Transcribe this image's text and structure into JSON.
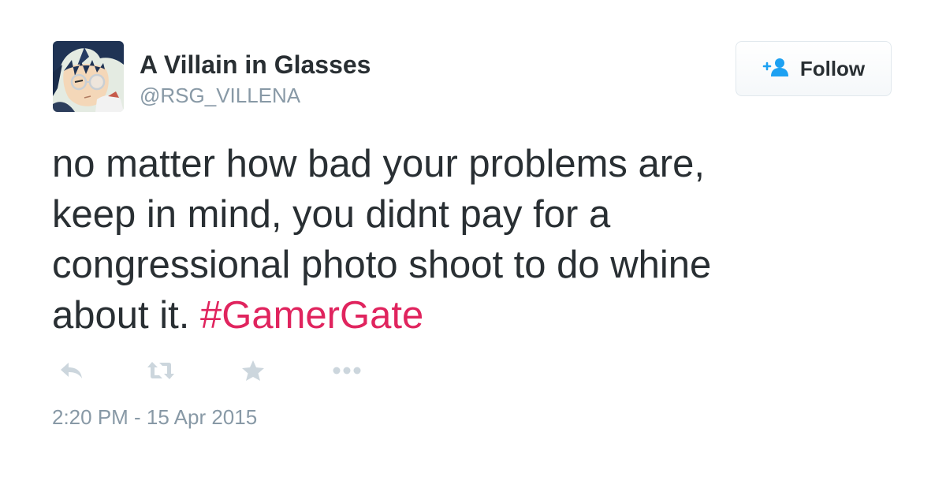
{
  "user": {
    "display_name": "A Villain in Glasses",
    "screen_name": "@RSG_VILLENA",
    "avatar_icon": "anime-character-avatar"
  },
  "follow_button": {
    "label": "Follow",
    "icon": "add-user-icon"
  },
  "tweet": {
    "line_1": "no matter how bad your problems are,",
    "line_2": "keep in mind, you didnt pay for a",
    "line_3": "congressional photo shoot to do whine",
    "line_4_text": "about it. ",
    "hashtag_symbol": "#",
    "hashtag_word": "GamerGate",
    "timestamp": "2:20 PM - 15 Apr 2015"
  },
  "actions": [
    {
      "icon": "reply-icon"
    },
    {
      "icon": "retweet-icon"
    },
    {
      "icon": "favorite-star-icon"
    },
    {
      "icon": "more-options-icon"
    }
  ],
  "colors": {
    "hashtag": "#e0245e",
    "secondary_text": "#8899a6",
    "action_icon": "#ccd6dd",
    "follow_icon": "#1da1f2"
  }
}
